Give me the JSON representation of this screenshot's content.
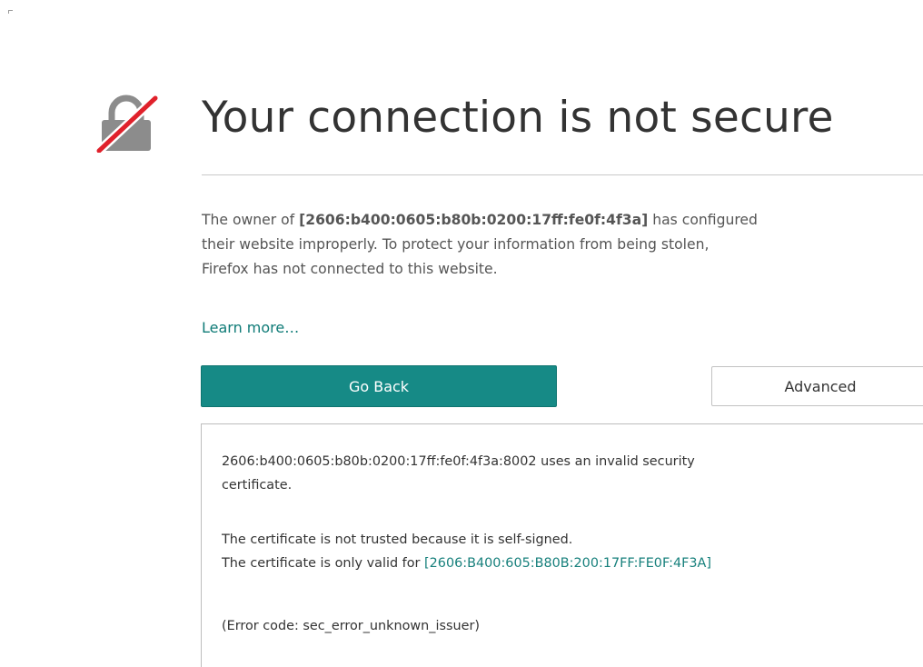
{
  "page": {
    "title": "Your connection is not secure",
    "description": {
      "prefix": "The owner of ",
      "host": "[2606:b400:0605:b80b:0200:17ff:fe0f:4f3a]",
      "line1_suffix": " has configured",
      "line2": "their website improperly. To protect your information from being stolen,",
      "line3": "Firefox has not connected to this website."
    },
    "learn_more_label": "Learn more…",
    "go_back_label": "Go Back",
    "advanced_label": "Advanced"
  },
  "advanced_panel": {
    "line1": "2606:b400:0605:b80b:0200:17ff:fe0f:4f3a:8002 uses an invalid security",
    "line2": "certificate.",
    "line3": "The certificate is not trusted because it is self-signed.",
    "line4_prefix": "The certificate is only valid for ",
    "valid_host_link": "[2606:B400:605:B80B:200:17FF:FE0F:4F3A]",
    "error_code": "(Error code: sec_error_unknown_issuer)"
  },
  "icons": {
    "warning": "broken-lock-icon"
  },
  "colors": {
    "accent": "#168a86",
    "link": "#0f7b77",
    "strike": "#e0212b",
    "lock": "#8c8c8c"
  }
}
